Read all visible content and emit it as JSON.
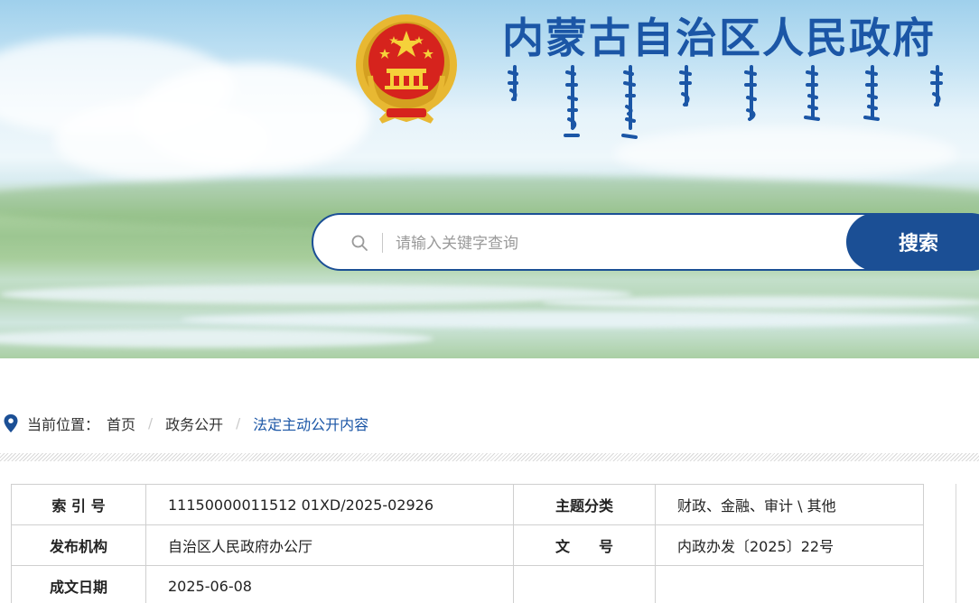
{
  "header": {
    "site_title": "内蒙古自治区人民政府",
    "emblem_icon": "national-emblem-icon",
    "mongolian_title_icon": "mongolian-script-title-icon",
    "brand_color": "#1b56a6"
  },
  "search": {
    "placeholder": "请输入关键字查询",
    "button_label": "搜索",
    "icon": "search-icon"
  },
  "breadcrumb": {
    "icon": "location-pin-icon",
    "label": "当前位置：",
    "items": [
      "首页",
      "政务公开",
      "法定主动公开内容"
    ],
    "separator": "/"
  },
  "info_table": {
    "rows": [
      [
        {
          "label": "索 引 号",
          "value": "11150000011512 01XD/2025-02926"
        },
        {
          "label": "主题分类",
          "value": "财政、金融、审计 \\ 其他"
        }
      ],
      [
        {
          "label": "发布机构",
          "value": "自治区人民政府办公厅"
        },
        {
          "label": "文　　号",
          "value": "内政办发〔2025〕22号"
        }
      ],
      [
        {
          "label": "成文日期",
          "value": "2025-06-08"
        },
        {
          "label": "",
          "value": ""
        }
      ]
    ]
  }
}
